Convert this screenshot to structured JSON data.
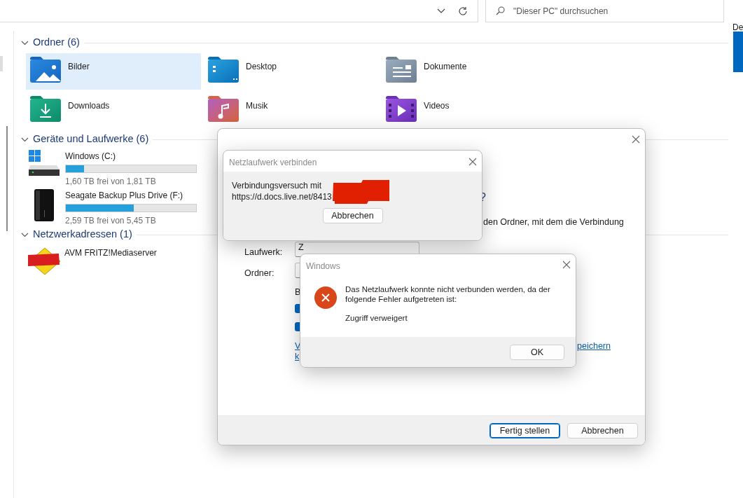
{
  "search": {
    "placeholder": "\"Dieser PC\" durchsuchen"
  },
  "edge_text": "De",
  "sections": [
    {
      "title": "Ordner (6)",
      "expanded": true,
      "kind": "folders",
      "items": [
        {
          "name": "Bilder",
          "kind": "pictures",
          "selected": true
        },
        {
          "name": "Desktop",
          "kind": "desktop",
          "selected": false
        },
        {
          "name": "Dokumente",
          "kind": "documents",
          "selected": false
        },
        {
          "name": "Downloads",
          "kind": "downloads",
          "selected": false
        },
        {
          "name": "Musik",
          "kind": "music",
          "selected": false
        },
        {
          "name": "Videos",
          "kind": "videos",
          "selected": false
        }
      ]
    },
    {
      "title": "Geräte und Laufwerke (6)",
      "expanded": true,
      "kind": "drives",
      "items": [
        {
          "name": "Windows (C:)",
          "kind": "system",
          "level": 0.14,
          "free": "1,60 TB frei von 1,81 TB",
          "selected": false
        },
        {
          "name": "Seagate Backup Plus Drive (F:)",
          "kind": "external",
          "level": 0.52,
          "free": "2,59 TB frei von 5,45 TB",
          "selected": false
        }
      ]
    },
    {
      "title": "Netzwerkadressen (1)",
      "expanded": true,
      "kind": "network",
      "items": [
        {
          "name": "AVM FRITZ!Mediaserver",
          "kind": "media-server",
          "selected": false
        }
      ]
    }
  ],
  "wizard": {
    "heading_fragment": "?",
    "description_fragment": "den Ordner, mit dem die Verbindung",
    "fields": [
      {
        "label": "Laufwerk:",
        "value": "Z"
      },
      {
        "label": "Ordner:"
      }
    ],
    "option_fragment": "B",
    "checkboxes": [
      {
        "checked": true
      },
      {
        "checked": true
      }
    ],
    "link_fragments": [
      "V",
      "k",
      "peichern"
    ],
    "buttons": [
      {
        "label": "Fertig stellen",
        "default": true
      },
      {
        "label": "Abbrechen",
        "default": false
      }
    ]
  },
  "progress_dialog": {
    "title": "Netzlaufwerk verbinden",
    "message_lines": [
      "Verbindungsversuch mit",
      "https://d.docs.live.net/8413"
    ],
    "button": "Abbrechen"
  },
  "error_dialog": {
    "title": "Windows",
    "message": "Das Netzlaufwerk konnte nicht verbunden werden, da der folgende Fehler aufgetreten ist:",
    "detail": "Zugriff verweigert",
    "button": "OK"
  }
}
